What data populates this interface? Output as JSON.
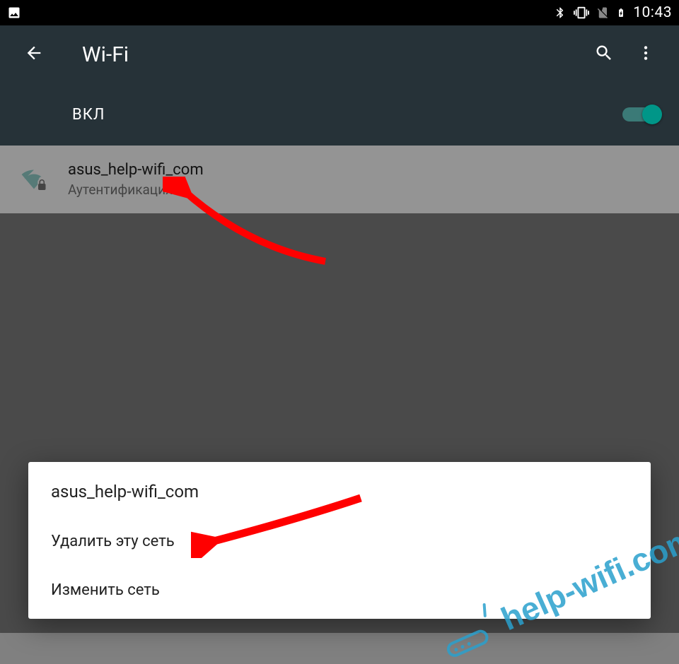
{
  "statusbar": {
    "time": "10:43"
  },
  "appbar": {
    "title": "Wi-Fi"
  },
  "toggle": {
    "label": "ВКЛ",
    "checked": true
  },
  "network": {
    "ssid": "asus_help-wifi_com",
    "status": "Аутентификация..."
  },
  "dialog": {
    "title": "asus_help-wifi_com",
    "delete": "Удалить эту сеть",
    "change": "Изменить сеть"
  },
  "watermark": {
    "text": "help-wifi.com"
  }
}
